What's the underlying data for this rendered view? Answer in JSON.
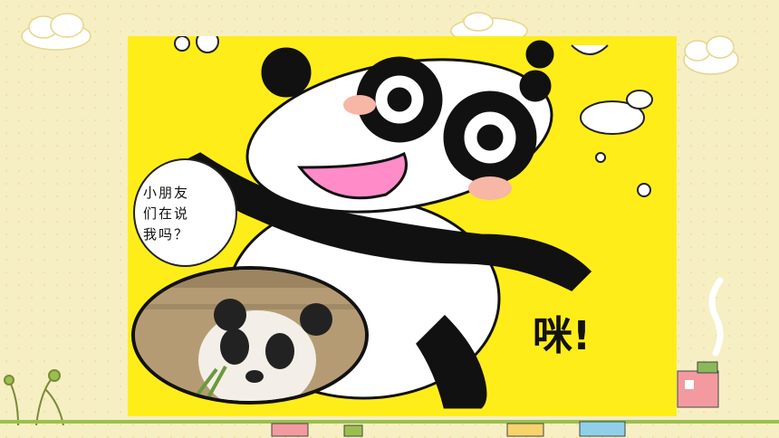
{
  "speech_bubble": {
    "line1": "小朋友",
    "line2": "们在说",
    "line3": "我吗？"
  },
  "sound_effect": "咪!",
  "colors": {
    "background": "#f6efc4",
    "panel": "#ffed1a",
    "cheek": "#f7b6a6",
    "tongue": "#ff8cc8"
  }
}
